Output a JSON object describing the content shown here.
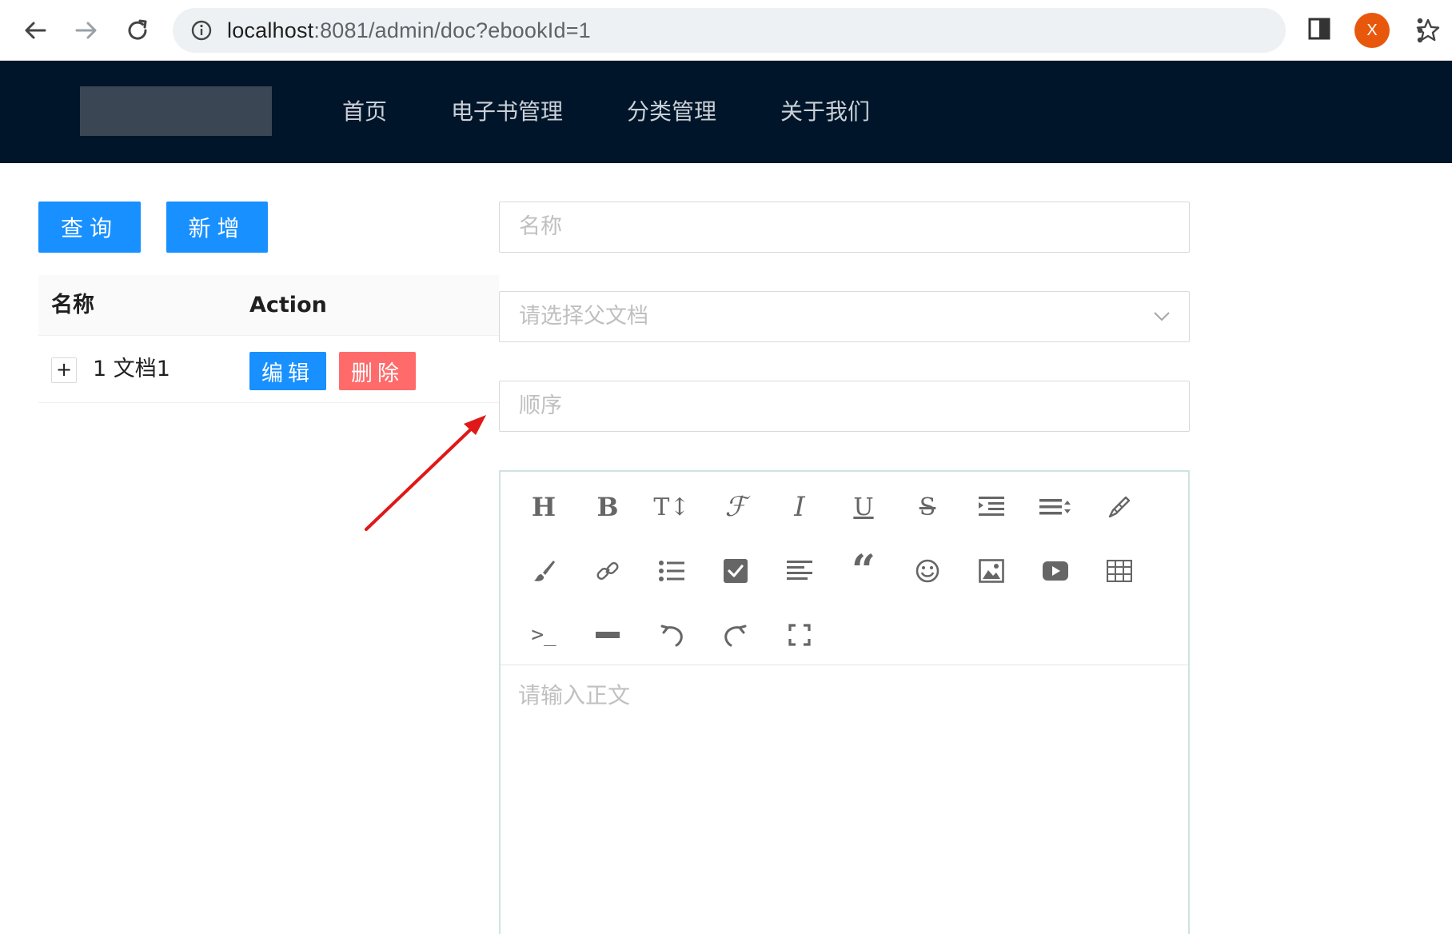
{
  "browser": {
    "url_host": "localhost",
    "url_path": ":8081/admin/doc?ebookId=1",
    "avatar_letter": "X"
  },
  "header": {
    "nav": [
      {
        "label": "首页"
      },
      {
        "label": "电子书管理"
      },
      {
        "label": "分类管理"
      },
      {
        "label": "关于我们"
      }
    ]
  },
  "actions": {
    "query_label": "查询",
    "add_label": "新增"
  },
  "table": {
    "columns": [
      "名称",
      "Action"
    ],
    "rows": [
      {
        "expand": "+",
        "name": "1 文档1",
        "edit_label": "编辑",
        "delete_label": "删除"
      }
    ]
  },
  "form": {
    "name_placeholder": "名称",
    "parent_placeholder": "请选择父文档",
    "sort_placeholder": "顺序",
    "content_placeholder": "请输入正文"
  },
  "editor_toolbar": [
    "heading-icon",
    "bold-icon",
    "font-size-icon",
    "font-family-icon",
    "italic-icon",
    "underline-icon",
    "strikethrough-icon",
    "indent-icon",
    "line-height-icon",
    "pen-icon",
    "paint-brush-icon",
    "link-icon",
    "bullet-list-icon",
    "checkbox-icon",
    "align-left-icon",
    "quote-icon",
    "emoji-icon",
    "image-icon",
    "video-icon",
    "table-icon",
    "code-icon",
    "divider-icon",
    "undo-icon",
    "redo-icon",
    "fullscreen-icon"
  ],
  "colors": {
    "primary": "#1890ff",
    "danger": "#ff6b6b",
    "header_bg": "#001529",
    "annotation_arrow": "#e01818"
  }
}
